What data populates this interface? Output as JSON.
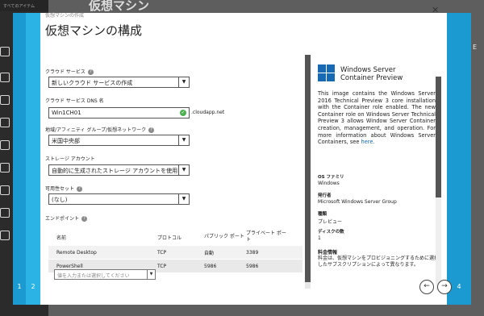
{
  "background": {
    "sidebar_top": "すべてのアイテム",
    "heading": "仮想マシン",
    "right_char": "E"
  },
  "wizard": {
    "breadcrumb": "仮想マシンの作成",
    "title": "仮想マシンの構成",
    "close_icon": "close-icon",
    "steps_left": [
      "1",
      "2"
    ],
    "step_right": "4",
    "cloud_service": {
      "label": "クラウド サービス",
      "value": "新しいクラウド サービスの作成"
    },
    "dns": {
      "label": "クラウド サービス DNS 名",
      "value": "Win1CH01",
      "suffix": ".cloudapp.net"
    },
    "region": {
      "label": "地域/アフィニティ グループ/仮想ネットワーク",
      "value": "米国中央部"
    },
    "storage": {
      "label": "ストレージ アカウント",
      "value": "自動的に生成されたストレージ アカウントを使用"
    },
    "availability": {
      "label": "可用性セット",
      "value": "(なし)"
    },
    "endpoints": {
      "label": "エンドポイント",
      "headers": [
        "名前",
        "プロトコル",
        "パブリック ポート",
        "プライベート ポート"
      ],
      "rows": [
        [
          "Remote Desktop",
          "TCP",
          "自動",
          "3389"
        ],
        [
          "PowerShell",
          "TCP",
          "5986",
          "5986"
        ]
      ],
      "input_placeholder": "値を入力または選択してください"
    }
  },
  "info": {
    "product_line1": "Windows Server",
    "product_line2": "Container Preview",
    "description": "This image contains the Windows Server 2016 Technical Preview 3 core installation with the Container role enabled. The new Container role on Windows Server Technical Preview 3 allows Window Server Container creation, management, and operation. For more information about Windows Server Containers, see",
    "link_text": "here.",
    "os_family_k": "OS ファミリ",
    "os_family_v": "Windows",
    "publisher_k": "発行者",
    "publisher_v": "Microsoft Windows Server Group",
    "type_k": "種類",
    "type_v": "プレビュー",
    "disks_k": "ディスクの数",
    "disks_v": "1",
    "pricing_k": "料金情報",
    "pricing_v": "料金は、仮想マシンをプロビジョニングするために選択したサブスクリプションによって異なります。"
  },
  "nav": {
    "back_icon": "arrow-left-icon",
    "next_icon": "arrow-right-icon"
  }
}
